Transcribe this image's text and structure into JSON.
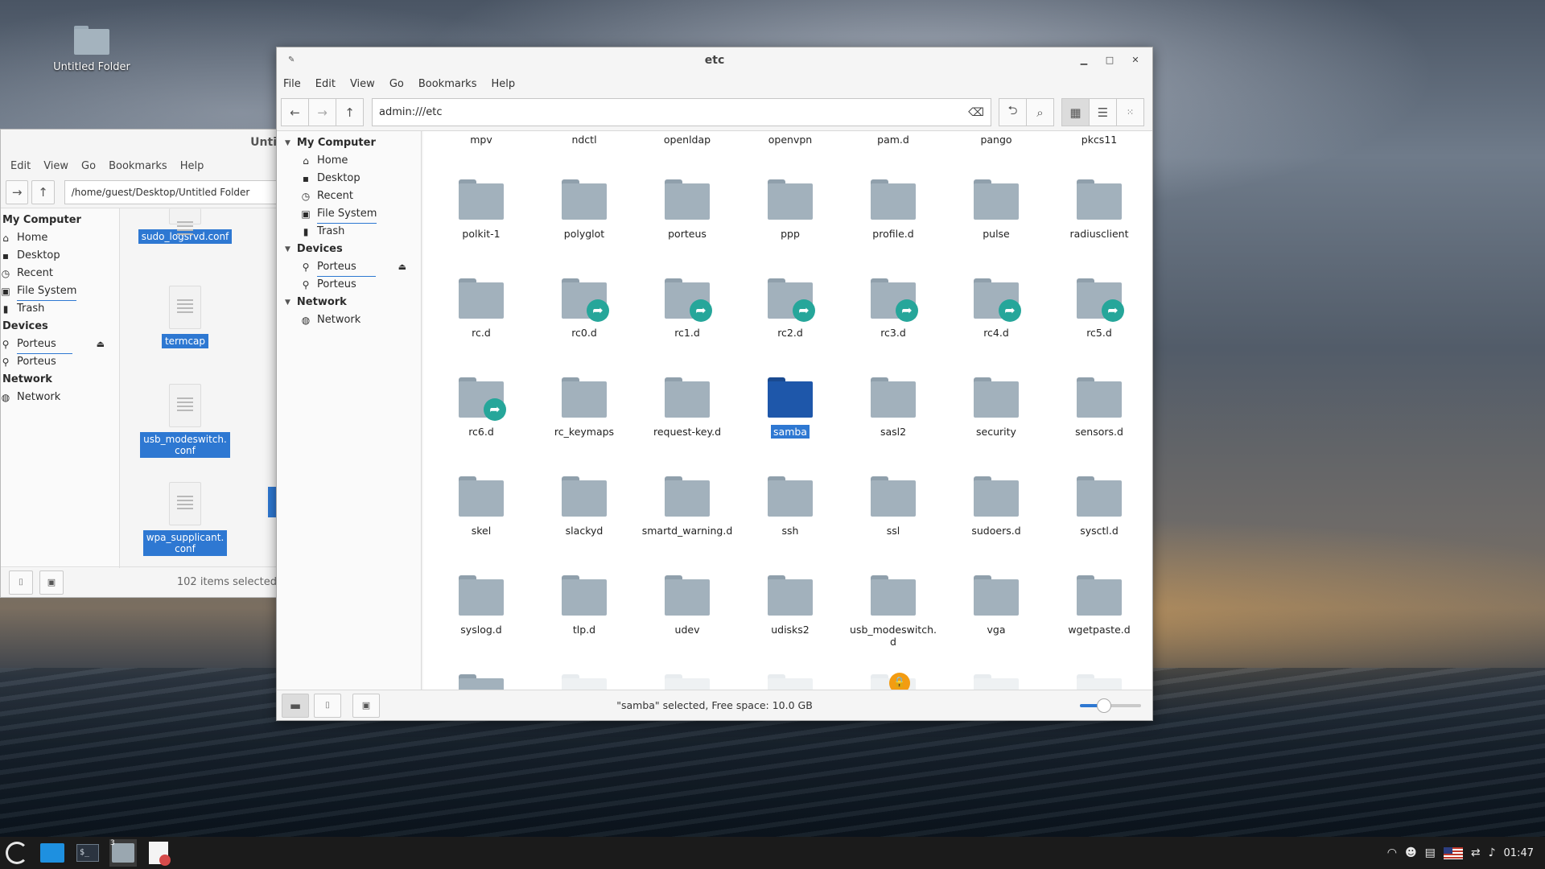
{
  "desktop": {
    "icons": [
      {
        "label": "Untitled Folder",
        "icon": "folder-icon"
      }
    ]
  },
  "back_window": {
    "title": "Unti",
    "menu": [
      "Edit",
      "View",
      "Go",
      "Bookmarks",
      "Help"
    ],
    "path": "/home/guest/Desktop/Untitled Folder",
    "sidebar": {
      "computer_head": "My Computer",
      "computer_items": [
        {
          "label": "Home",
          "icon": "home-icon"
        },
        {
          "label": "Desktop",
          "icon": "desktop-icon"
        },
        {
          "label": "Recent",
          "icon": "recent-icon"
        },
        {
          "label": "File System",
          "icon": "drive-icon"
        },
        {
          "label": "Trash",
          "icon": "trash-icon"
        }
      ],
      "devices_head": "Devices",
      "device_items": [
        {
          "label": "Porteus",
          "icon": "usb-icon"
        },
        {
          "label": "Porteus",
          "icon": "usb-icon"
        }
      ],
      "network_head": "Network",
      "network_items": [
        {
          "label": "Network",
          "icon": "network-icon"
        }
      ]
    },
    "files": [
      {
        "label": "sudo_logsrvd.conf"
      },
      {
        "label": "termcap"
      },
      {
        "label_lines": [
          "usb_modeswitch.",
          "conf"
        ]
      },
      {
        "label_lines": [
          "wpa_supplicant.",
          "conf"
        ]
      }
    ],
    "status": "102 items selected"
  },
  "window": {
    "title": "etc",
    "menu": [
      "File",
      "Edit",
      "View",
      "Go",
      "Bookmarks",
      "Help"
    ],
    "path": "admin:///etc",
    "sidebar": {
      "computer_head": "My Computer",
      "computer_items": [
        {
          "label": "Home",
          "icon": "home-icon"
        },
        {
          "label": "Desktop",
          "icon": "desktop-icon"
        },
        {
          "label": "Recent",
          "icon": "recent-icon"
        },
        {
          "label": "File System",
          "icon": "drive-icon"
        },
        {
          "label": "Trash",
          "icon": "trash-icon"
        }
      ],
      "devices_head": "Devices",
      "device_items": [
        {
          "label": "Porteus",
          "icon": "usb-icon"
        },
        {
          "label": "Porteus",
          "icon": "usb-icon"
        }
      ],
      "network_head": "Network",
      "network_items": [
        {
          "label": "Network",
          "icon": "network-icon"
        }
      ]
    },
    "top_row": [
      "mpv",
      "ndctl",
      "openldap",
      "openvpn",
      "pam.d",
      "pango",
      "pkcs11"
    ],
    "rows": [
      [
        {
          "name": "polkit-1"
        },
        {
          "name": "polyglot"
        },
        {
          "name": "porteus"
        },
        {
          "name": "ppp"
        },
        {
          "name": "profile.d"
        },
        {
          "name": "pulse"
        },
        {
          "name": "radiusclient"
        }
      ],
      [
        {
          "name": "rc.d"
        },
        {
          "name": "rc0.d",
          "badge": "link"
        },
        {
          "name": "rc1.d",
          "badge": "link"
        },
        {
          "name": "rc2.d",
          "badge": "link"
        },
        {
          "name": "rc3.d",
          "badge": "link"
        },
        {
          "name": "rc4.d",
          "badge": "link"
        },
        {
          "name": "rc5.d",
          "badge": "link"
        }
      ],
      [
        {
          "name": "rc6.d",
          "badge": "link"
        },
        {
          "name": "rc_keymaps"
        },
        {
          "name": "request-key.d"
        },
        {
          "name": "samba",
          "selected": true
        },
        {
          "name": "sasl2"
        },
        {
          "name": "security"
        },
        {
          "name": "sensors.d"
        }
      ],
      [
        {
          "name": "skel"
        },
        {
          "name": "slackyd"
        },
        {
          "name": "smartd_warning.d"
        },
        {
          "name": "ssh"
        },
        {
          "name": "ssl"
        },
        {
          "name": "sudoers.d"
        },
        {
          "name": "sysctl.d"
        }
      ],
      [
        {
          "name": "syslog.d"
        },
        {
          "name": "tlp.d"
        },
        {
          "name": "udev"
        },
        {
          "name": "udisks2"
        },
        {
          "name": "usb_modeswitch.",
          "name2": "d"
        },
        {
          "name": "vga"
        },
        {
          "name": "wgetpaste.d"
        }
      ]
    ],
    "status": "\"samba\" selected, Free space: 10.0 GB",
    "zoom_fraction": 0.4
  },
  "taskbar": {
    "files_badge": "3",
    "clock": "01:47"
  }
}
